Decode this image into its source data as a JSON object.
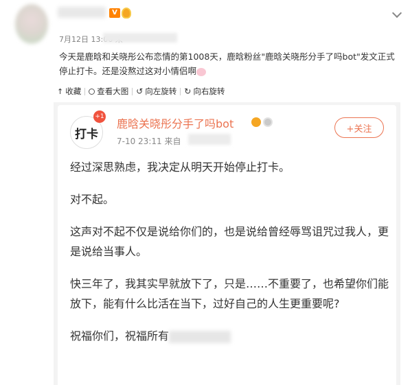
{
  "post": {
    "time_prefix": "7月12日 13:06 来",
    "text": "今天是鹿晗和关晓彤公布恋情的第1008天，鹿晗粉丝\"鹿晗关晓彤分手了吗bot\"发文正式停止打卡。还是没熬过这对小情侣啊",
    "toolbar": {
      "collect": "收藏",
      "view_large": "查看大图",
      "rotate_left": "向左旋转",
      "rotate_right": "向右旋转"
    }
  },
  "card": {
    "avatar_text": "打卡",
    "notif": "+1",
    "name": "鹿晗关晓彤分手了吗bot",
    "time": "7-10 23:11  来自",
    "follow": "+关注",
    "paragraphs": [
      "经过深思熟虑，我决定从明天开始停止打卡。",
      "对不起。",
      "这声对不起不仅是说给你们的，也是说给曾经辱骂诅咒过我人，更是说给当事人。",
      "快三年了，我其实早就放下了，只是……不重要了，也希望你们能放下，能有什么比活在当下，过好自己的人生更重要呢?",
      "祝福你们，祝福所有"
    ]
  },
  "icons": [
    "v-badge-icon",
    "medal-icon",
    "chevron-down-icon",
    "arrow-up-icon",
    "search-icon",
    "rotate-left-icon",
    "rotate-right-icon",
    "crown-icon",
    "silver-medal-icon"
  ]
}
